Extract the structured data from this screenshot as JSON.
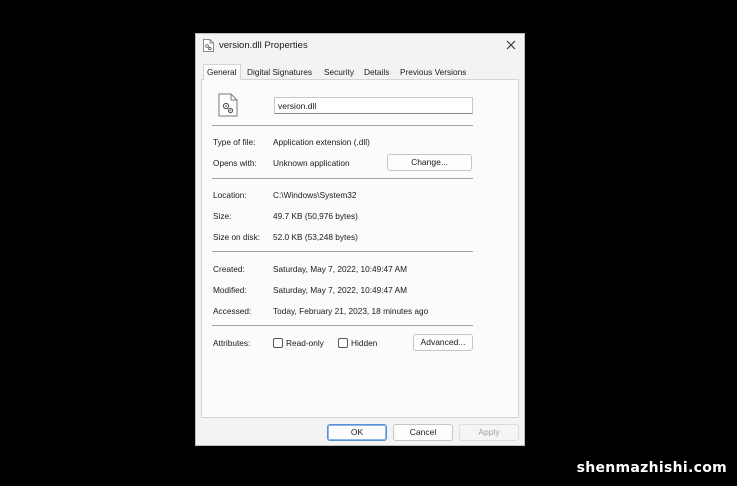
{
  "window": {
    "title": "version.dll Properties",
    "title_icon": "dll-file-icon",
    "close_icon": "close-icon"
  },
  "tabs": [
    {
      "label": "General",
      "active": true
    },
    {
      "label": "Digital Signatures",
      "active": false
    },
    {
      "label": "Security",
      "active": false
    },
    {
      "label": "Details",
      "active": false
    },
    {
      "label": "Previous Versions",
      "active": false
    }
  ],
  "general": {
    "file_name": "version.dll",
    "type": {
      "label": "Type of file:",
      "value": "Application extension (.dll)"
    },
    "opens_with": {
      "label": "Opens with:",
      "value": "Unknown application",
      "button": "Change..."
    },
    "location": {
      "label": "Location:",
      "value": "C:\\Windows\\System32"
    },
    "size": {
      "label": "Size:",
      "value": "49.7 KB (50,976 bytes)"
    },
    "size_on_disk": {
      "label": "Size on disk:",
      "value": "52.0 KB (53,248 bytes)"
    },
    "created": {
      "label": "Created:",
      "value": "Saturday, May 7, 2022, 10:49:47 AM"
    },
    "modified": {
      "label": "Modified:",
      "value": "Saturday, May 7, 2022, 10:49:47 AM"
    },
    "accessed": {
      "label": "Accessed:",
      "value": "Today, February 21, 2023, 18 minutes ago"
    },
    "attributes": {
      "label": "Attributes:",
      "read_only": {
        "label": "Read-only",
        "checked": false
      },
      "hidden": {
        "label": "Hidden",
        "checked": false
      },
      "advanced_button": "Advanced..."
    }
  },
  "footer": {
    "ok": "OK",
    "cancel": "Cancel",
    "apply": "Apply"
  },
  "watermark": "shenmazhishi.com"
}
